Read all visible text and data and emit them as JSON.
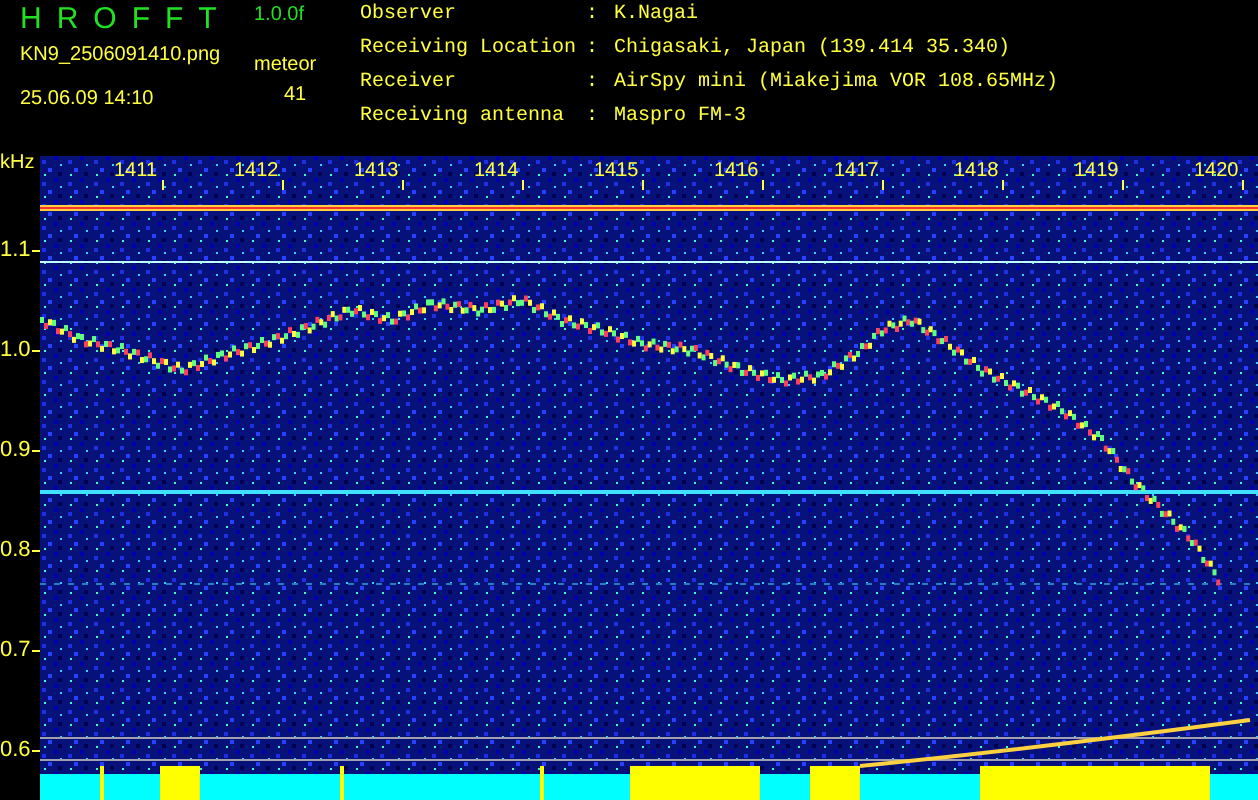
{
  "header": {
    "app_title": "HROFFT",
    "version": "1.0.0f",
    "filename": "KN9_2506091410.png",
    "timestamp": "25.06.09 14:10",
    "count_label": "meteor",
    "count": "41"
  },
  "station_info": [
    {
      "label": "Observer",
      "separator": ":",
      "value": "K.Nagai"
    },
    {
      "label": "Receiving Location",
      "separator": ":",
      "value": "Chigasaki, Japan (139.414 35.340)"
    },
    {
      "label": "Receiver",
      "separator": ":",
      "value": "AirSpy mini (Miakejima VOR 108.65MHz)"
    },
    {
      "label": "Receiving antenna",
      "separator": ":",
      "value": "Maspro FM-3"
    }
  ],
  "spectrogram": {
    "y_unit": "kHz",
    "y_labels": [
      "1.1",
      "1.0",
      "0.9",
      "0.8",
      "0.7",
      "0.6"
    ],
    "time_labels": [
      "1411",
      "1412",
      "1413",
      "1414",
      "1415",
      "1416",
      "1417",
      "1418",
      "1419",
      "1420"
    ]
  }
}
